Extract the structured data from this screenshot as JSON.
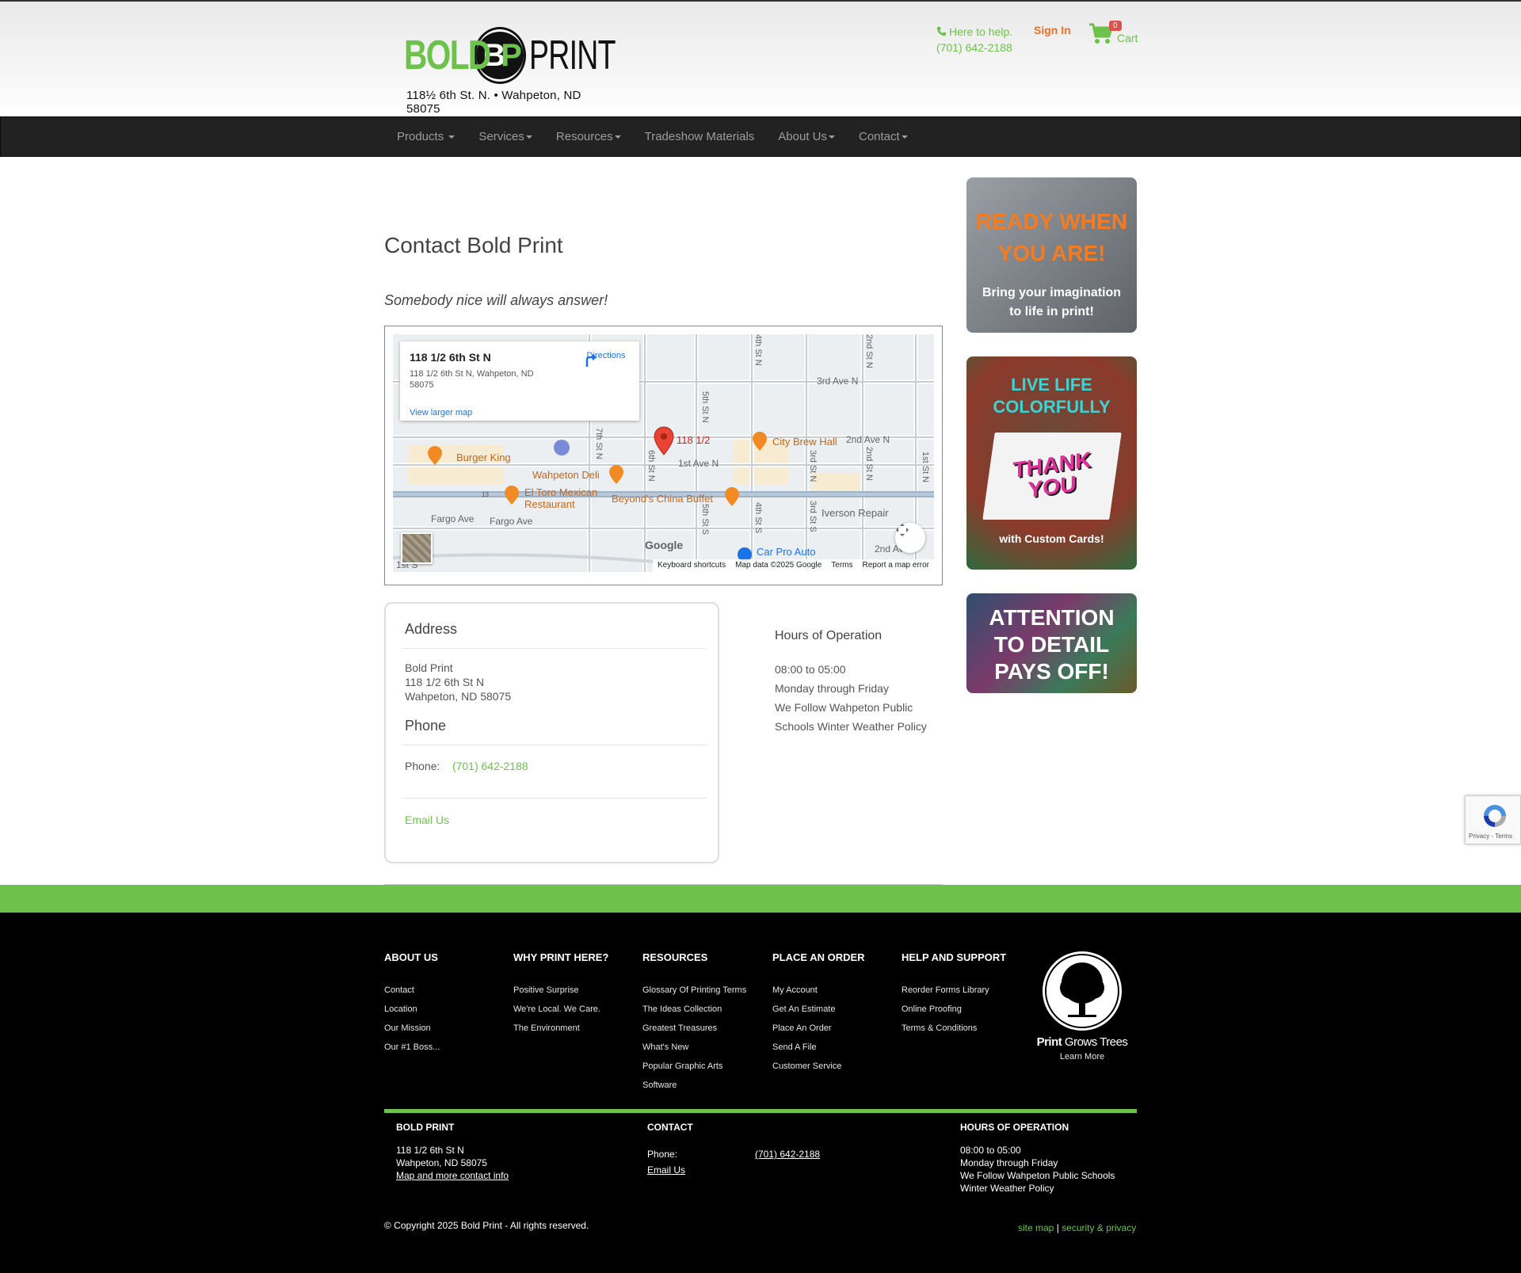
{
  "header": {
    "logo_bold": "BOLD",
    "logo_badge_b": "B",
    "logo_badge_p": "P",
    "logo_print": "PRINT",
    "logo_address": "118½ 6th St. N. • Wahpeton, ND 58075",
    "help_text": "Here to help.",
    "help_phone": "(701) 642-2188",
    "signin": "Sign In",
    "cart_count": "0",
    "cart_label": "Cart"
  },
  "nav": {
    "products": "Products",
    "services": "Services",
    "resources": "Resources",
    "tradeshow": "Tradeshow Materials",
    "about": "About Us",
    "contact": "Contact"
  },
  "main": {
    "title": "Contact Bold Print",
    "tagline": "Somebody nice will always answer!"
  },
  "map": {
    "card_title": "118 1/2 6th St N",
    "card_address": "118 1/2 6th St N, Wahpeton, ND 58075",
    "directions": "Directions",
    "larger_map": "View larger map",
    "pin_label": "118 1/2",
    "google": "Google",
    "footer_shortcuts": "Keyboard shortcuts",
    "footer_data": "Map data ©2025 Google",
    "footer_terms": "Terms",
    "footer_report": "Report a map error",
    "labels": {
      "burger_king": "Burger King",
      "wahpeton_deli": "Wahpeton Deli",
      "el_toro": "El Toro Mexican",
      "el_toro2": "Restaurant",
      "beyonds": "Beyond's China Buffet",
      "city_brew": "City Brew Hall",
      "iverson": "Iverson Repair",
      "car_pro": "Car Pro Auto",
      "third_ave": "3rd Ave N",
      "second_ave": "2nd Ave N",
      "first_ave": "1st Ave N",
      "fargo1": "Fargo Ave",
      "fargo2": "Fargo Ave",
      "second_ave_s": "2nd Ave",
      "first_st_s": "1st S",
      "seventh_st": "7th St N",
      "sixth_st": "6th St N",
      "fifth_st": "5th St N",
      "fifth_st_s": "5th St S",
      "fourth_st": "4th St N",
      "fourth_st_s": "4th St S",
      "third_st": "3rd St N",
      "third_st_s": "3rd St S",
      "second_st": "2nd St N",
      "second_st2": "2nd St N",
      "first_st": "1st St N",
      "route_13": "13"
    }
  },
  "address_box": {
    "address_heading": "Address",
    "company": "Bold Print",
    "street": "118 1/2 6th St N",
    "city": "Wahpeton, ND 58075",
    "phone_heading": "Phone",
    "phone_label": "Phone:",
    "phone_value": "(701) 642-2188",
    "email_link": "Email Us"
  },
  "hours": {
    "heading": "Hours of Operation",
    "time": "08:00 to 05:00",
    "days": "Monday through Friday",
    "policy1": "We Follow Wahpeton Public",
    "policy2": "Schools Winter Weather Policy"
  },
  "ads": {
    "ad1_line1": "READY WHEN",
    "ad1_line2": "YOU ARE!",
    "ad1_sub1": "Bring your imagination",
    "ad1_sub2": "to life in print!",
    "ad2_line1": "LIVE LIFE",
    "ad2_line2": "COLORFULLY",
    "ad2_card1": "THANK",
    "ad2_card2": "YOU",
    "ad2_sub": "with Custom Cards!",
    "ad3_line1": "ATTENTION",
    "ad3_line2": "TO DETAIL",
    "ad3_line3": "PAYS OFF!"
  },
  "recaptcha": {
    "text": "Privacy - Terms"
  },
  "footer": {
    "about": {
      "title": "ABOUT US",
      "items": [
        "Contact",
        "Location",
        "Our Mission",
        "Our #1 Boss..."
      ]
    },
    "why": {
      "title": "WHY PRINT HERE?",
      "items": [
        "Positive Surprise",
        "We're Local. We Care.",
        "The Environment"
      ]
    },
    "resources": {
      "title": "RESOURCES",
      "items": [
        "Glossary Of Printing Terms",
        "The Ideas Collection",
        "Greatest Treasures",
        "What's New",
        "Popular Graphic Arts",
        "Software"
      ]
    },
    "order": {
      "title": "PLACE AN ORDER",
      "items": [
        "My Account",
        "Get An Estimate",
        "Place An Order",
        "Send A File",
        "Customer Service"
      ]
    },
    "help": {
      "title": "HELP AND SUPPORT",
      "items": [
        "Reorder Forms Library",
        "Online Proofing",
        "Terms & Conditions"
      ]
    },
    "trees": {
      "bold": "Print",
      "light": "Grows Trees",
      "learn": "Learn More"
    },
    "info": {
      "company_title": "BOLD PRINT",
      "street": "118 1/2 6th St N",
      "city": "Wahpeton, ND 58075",
      "map_link": "Map and more contact info",
      "contact_title": "CONTACT",
      "phone_label": "Phone:",
      "phone_value": "(701) 642-2188",
      "email": "Email Us",
      "hours_title": "HOURS OF OPERATION",
      "time": "08:00 to 05:00",
      "days": "Monday through Friday",
      "policy1": "We Follow Wahpeton Public Schools",
      "policy2": "Winter Weather Policy"
    },
    "copyright": "© Copyright 2025 Bold Print - All rights reserved.",
    "site_map": "site map",
    "separator": "|",
    "security": "security & privacy"
  },
  "colors": {
    "green": "#6cc24a",
    "orange": "#e8702a",
    "nav_bg": "#222222"
  }
}
